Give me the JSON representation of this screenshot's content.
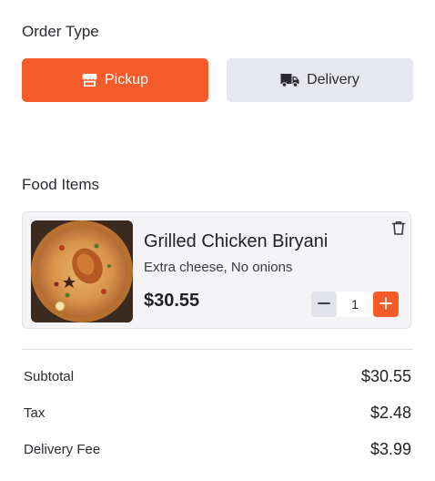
{
  "order_type": {
    "title": "Order Type",
    "pickup_label": "Pickup",
    "delivery_label": "Delivery",
    "selected": "Pickup"
  },
  "food_items": {
    "title": "Food Items",
    "items": [
      {
        "name": "Grilled Chicken Biryani",
        "description": "Extra cheese, No onions",
        "price": "$30.55",
        "quantity": "1"
      }
    ]
  },
  "summary": {
    "subtotal_label": "Subtotal",
    "subtotal_value": "$30.55",
    "tax_label": "Tax",
    "tax_value": "$2.48",
    "delivery_fee_label": "Delivery Fee",
    "delivery_fee_value": "$3.99"
  },
  "icons": {
    "pickup": "store-icon",
    "delivery": "truck-icon",
    "remove": "trash-icon",
    "decrement": "minus-icon",
    "increment": "plus-icon"
  },
  "colors": {
    "accent": "#f45b29",
    "secondary_button": "#e7e7ef",
    "card_background": "#f4f4f7"
  }
}
